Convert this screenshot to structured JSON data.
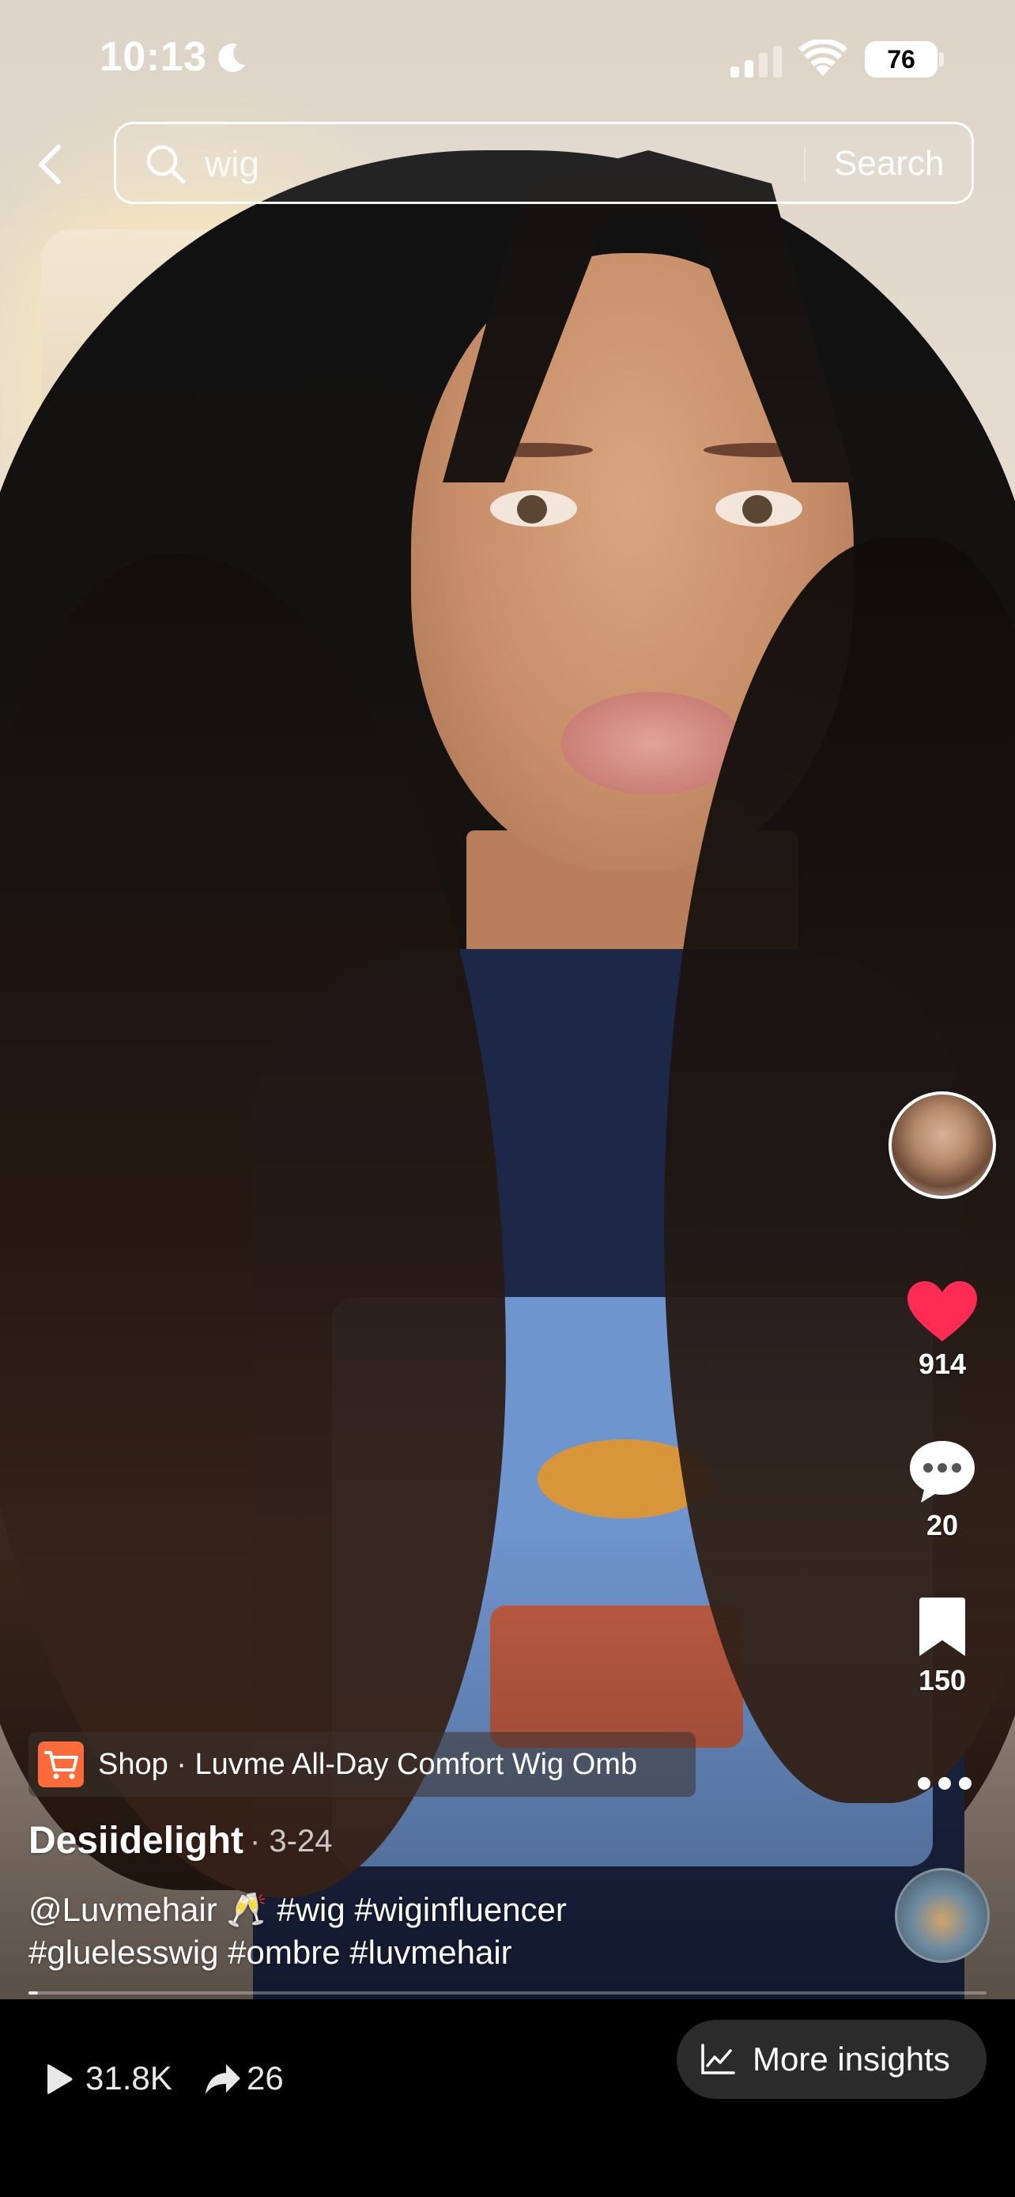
{
  "status_bar": {
    "time": "10:13",
    "battery": "76"
  },
  "search": {
    "query": "wig",
    "button_label": "Search"
  },
  "creator": {
    "username": "Desiidelight",
    "date": "· 3-24"
  },
  "actions": {
    "likes": "914",
    "comments": "20",
    "saves": "150"
  },
  "shop": {
    "label": "Shop · Luvme All-Day Comfort Wig Omb"
  },
  "caption": {
    "line1": "@Luvmehair 🥂 #wig #wiginfluencer",
    "line2": "#gluelesswig #ombre #luvmehair"
  },
  "insights": {
    "views": "31.8K",
    "shares": "26",
    "more_label": "More insights"
  },
  "colors": {
    "like": "#fe2c55",
    "shop_cart": "#fe6b3a",
    "insights_button": "#2b2b2b"
  },
  "icons": [
    "moon-icon",
    "signal-icon",
    "wifi-icon",
    "back-icon",
    "search-icon",
    "heart-icon",
    "comment-icon",
    "bookmark-icon",
    "more-icon",
    "cart-icon",
    "play-icon",
    "share-icon",
    "chart-icon"
  ]
}
